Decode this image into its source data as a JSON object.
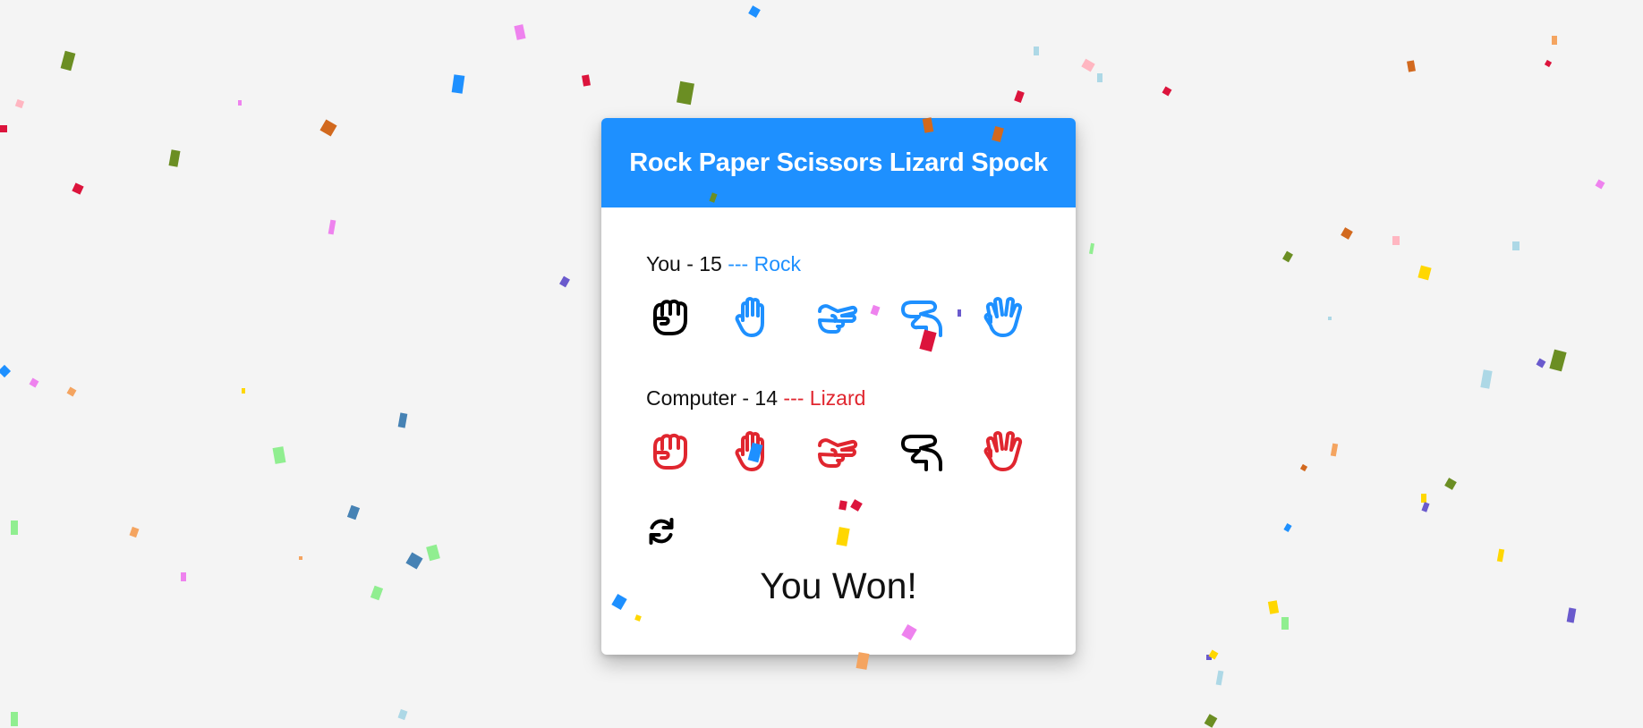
{
  "app": {
    "title": "Rock Paper Scissors Lizard Spock"
  },
  "player": {
    "label": "You - 15",
    "choice_text": "--- Rock",
    "color": "#1e90ff",
    "selected": "rock"
  },
  "computer": {
    "label": "Computer - 14",
    "choice_text": "--- Lizard",
    "color": "#e0262f",
    "selected": "lizard"
  },
  "hands": [
    {
      "id": "rock",
      "icon": "hand-fist-icon"
    },
    {
      "id": "paper",
      "icon": "hand-paper-icon"
    },
    {
      "id": "scissors",
      "icon": "hand-scissors-icon"
    },
    {
      "id": "lizard",
      "icon": "hand-lizard-icon"
    },
    {
      "id": "spock",
      "icon": "hand-spock-icon"
    }
  ],
  "reset": {
    "icon": "refresh-icon"
  },
  "result": {
    "text": "You Won!"
  },
  "colors": {
    "background": "#f4f4f4",
    "header": "#1e90ff",
    "selected": "#000000"
  },
  "confetti_colors": [
    "#6b8e23",
    "#1e90ff",
    "#dc143c",
    "#ee82ee",
    "#ffd700",
    "#d2691e",
    "#add8e6",
    "#ffb6c1",
    "#90ee90",
    "#6a5acd",
    "#f4a460",
    "#4682b4"
  ]
}
